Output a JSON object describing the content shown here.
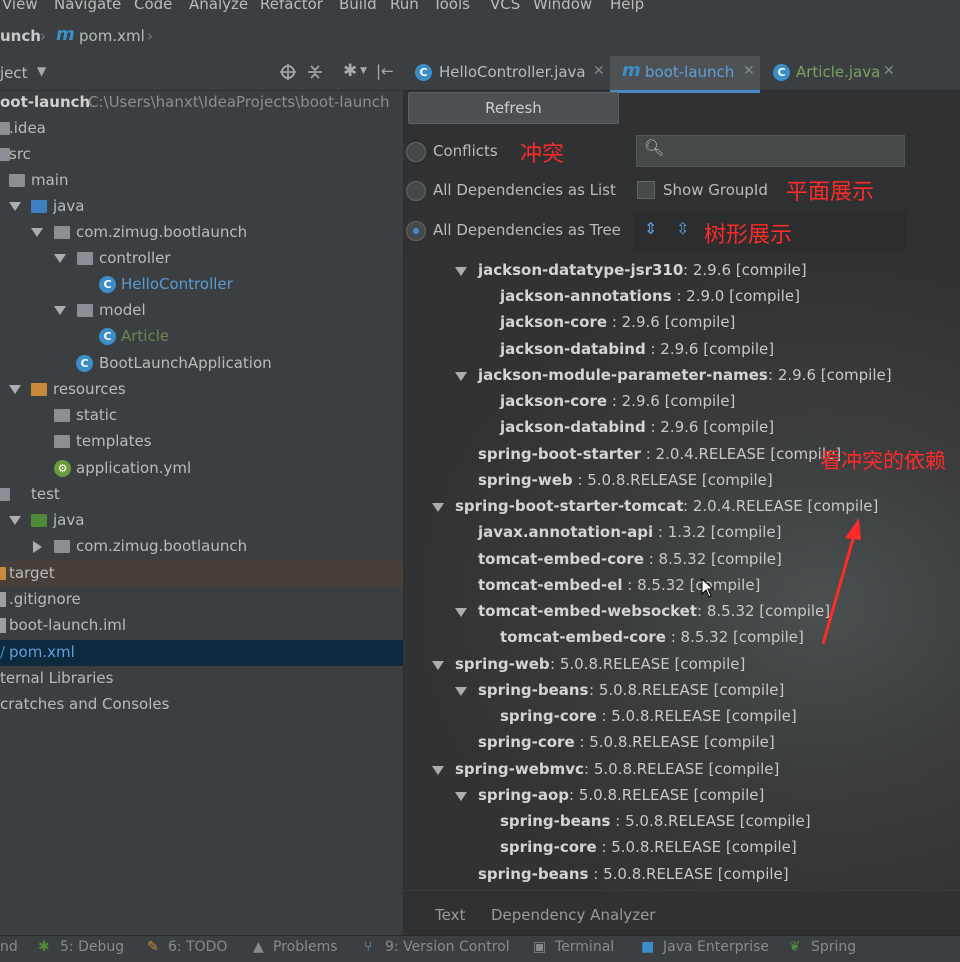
{
  "menu": [
    "View",
    "Navigate",
    "Code",
    "Analyze",
    "Refactor",
    "Build",
    "Run",
    "Tools",
    "VCS",
    "Window",
    "Help"
  ],
  "breadcrumb": {
    "project": "unch",
    "file": "pom.xml"
  },
  "project_panel": {
    "title": "ject",
    "root": {
      "name": "oot-launch",
      "path": "C:\\Users\\hanxt\\IdeaProjects\\boot-launch"
    },
    "items": [
      ".idea",
      "src",
      "main",
      "java",
      "com.zimug.bootlaunch",
      "controller",
      "HelloController",
      "model",
      "Article",
      "BootLaunchApplication",
      "resources",
      "static",
      "templates",
      "application.yml",
      "test",
      "java",
      "com.zimug.bootlaunch",
      "target",
      ".gitignore",
      "boot-launch.iml",
      "pom.xml"
    ],
    "external": [
      "ternal Libraries",
      "cratches and Consoles"
    ]
  },
  "editor_tabs": [
    {
      "label": "HelloController.java",
      "icon": "class-icon"
    },
    {
      "label": "boot-launch",
      "icon": "maven-icon"
    },
    {
      "label": "Article.java",
      "icon": "class-icon"
    }
  ],
  "dependency_analyzer": {
    "refresh": "Refresh",
    "radio_conflicts": "Conflicts",
    "radio_list": "All Dependencies as List",
    "radio_tree": "All Dependencies as Tree",
    "show_groupid": "Show GroupId",
    "tree": [
      {
        "name": "jackson-datatype-jsr310",
        "ver": " : 2.9.6 [compile]"
      },
      {
        "name": "jackson-annotations",
        "ver": " : 2.9.0 [compile]"
      },
      {
        "name": "jackson-core",
        "ver": " : 2.9.6 [compile]"
      },
      {
        "name": "jackson-databind",
        "ver": " : 2.9.6 [compile]"
      },
      {
        "name": "jackson-module-parameter-names",
        "ver": " : 2.9.6 [compile]"
      },
      {
        "name": "jackson-core",
        "ver": " : 2.9.6 [compile]"
      },
      {
        "name": "jackson-databind",
        "ver": " : 2.9.6 [compile]"
      },
      {
        "name": "spring-boot-starter",
        "ver": " : 2.0.4.RELEASE [compile]"
      },
      {
        "name": "spring-web",
        "ver": " : 5.0.8.RELEASE [compile]"
      },
      {
        "name": "spring-boot-starter-tomcat",
        "ver": " : 2.0.4.RELEASE [compile]"
      },
      {
        "name": "javax.annotation-api",
        "ver": " : 1.3.2 [compile]"
      },
      {
        "name": "tomcat-embed-core",
        "ver": " : 8.5.32 [compile]"
      },
      {
        "name": "tomcat-embed-el",
        "ver": " : 8.5.32 [compile]"
      },
      {
        "name": "tomcat-embed-websocket",
        "ver": " : 8.5.32 [compile]"
      },
      {
        "name": "tomcat-embed-core",
        "ver": " : 8.5.32 [compile]"
      },
      {
        "name": "spring-web",
        "ver": " : 5.0.8.RELEASE [compile]"
      },
      {
        "name": "spring-beans",
        "ver": " : 5.0.8.RELEASE [compile]"
      },
      {
        "name": "spring-core",
        "ver": " : 5.0.8.RELEASE [compile]"
      },
      {
        "name": "spring-core",
        "ver": " : 5.0.8.RELEASE [compile]"
      },
      {
        "name": "spring-webmvc",
        "ver": " : 5.0.8.RELEASE [compile]"
      },
      {
        "name": "spring-aop",
        "ver": " : 5.0.8.RELEASE [compile]"
      },
      {
        "name": "spring-beans",
        "ver": " : 5.0.8.RELEASE [compile]"
      },
      {
        "name": "spring-core",
        "ver": " : 5.0.8.RELEASE [compile]"
      },
      {
        "name": "spring-beans",
        "ver": " : 5.0.8.RELEASE [compile]"
      }
    ],
    "bottom_tabs": [
      "Text",
      "Dependency Analyzer"
    ]
  },
  "annotations": {
    "conflicts": "冲突",
    "flat": "平面展示",
    "tree": "树形展示",
    "see_conflicts": "看冲突的依赖"
  },
  "tool_windows": [
    "nd",
    "5: Debug",
    "6: TODO",
    "Problems",
    "9: Version Control",
    "Terminal",
    "Java Enterprise",
    "Spring"
  ],
  "colors": {
    "selected_row": "#0d293e",
    "annotation": "#ff2a2a",
    "accent": "#3b8ec6"
  }
}
